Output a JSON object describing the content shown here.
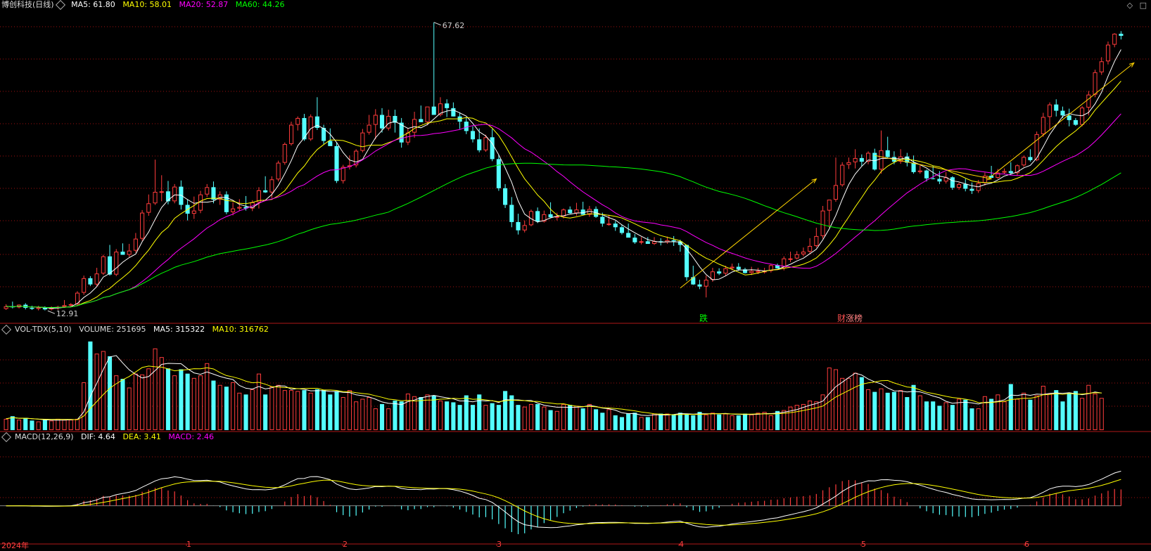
{
  "header": {
    "title": "博创科技(日线)",
    "ma5": "MA5: 61.80",
    "ma10": "MA10: 58.01",
    "ma20": "MA20: 52.87",
    "ma60": "MA60: 44.26"
  },
  "volume_header": {
    "indicator": "VOL-TDX(5,10)",
    "volume": "VOLUME: 251695",
    "ma5": "MA5: 315322",
    "ma10": "MA10: 316762"
  },
  "macd_header": {
    "indicator": "MACD(12,26,9)",
    "dif": "DIF: 4.64",
    "dea": "DEA: 3.41",
    "macd": "MACD: 2.46"
  },
  "annotations": {
    "high": "67.62",
    "low": "12.91",
    "event_drop": "跌",
    "event_cai": "财",
    "event_rise": "涨榜"
  },
  "x_axis": {
    "year": "2024年",
    "months": [
      "1",
      "2",
      "3",
      "4",
      "5",
      "6"
    ]
  },
  "corner": {
    "diamond": "◇",
    "square": "□"
  },
  "colors": {
    "background": "#000000",
    "up": "#ff3c3c",
    "down": "#54ffff",
    "ma5": "#ffffff",
    "ma10": "#ffff00",
    "ma20": "#ff00ff",
    "ma60": "#00ff00",
    "grid": "#a01010"
  },
  "chart_data": {
    "type": "candlestick",
    "price_range": [
      10,
      70
    ],
    "candles": [
      [
        12.5,
        13.4,
        12.3,
        13.0
      ],
      [
        13.0,
        13.9,
        12.6,
        12.8
      ],
      [
        12.8,
        13.4,
        12.6,
        13.3
      ],
      [
        13.3,
        13.6,
        12.4,
        12.7
      ],
      [
        12.7,
        13.1,
        12.3,
        12.5
      ],
      [
        12.5,
        13.1,
        12.2,
        12.8
      ],
      [
        12.8,
        13.0,
        12.2,
        12.4
      ],
      [
        12.4,
        13.0,
        12.2,
        12.7
      ],
      [
        12.7,
        13.1,
        12.3,
        12.9
      ],
      [
        12.9,
        14.2,
        12.7,
        13.2
      ],
      [
        13.2,
        13.6,
        12.9,
        13.4
      ],
      [
        13.4,
        15.9,
        13.1,
        15.6
      ],
      [
        15.6,
        18.9,
        15.2,
        18.4
      ],
      [
        18.4,
        18.8,
        16.9,
        17.2
      ],
      [
        17.2,
        20.4,
        16.9,
        19.3
      ],
      [
        19.3,
        22.9,
        19.0,
        22.6
      ],
      [
        22.6,
        24.8,
        18.9,
        19.1
      ],
      [
        19.1,
        24.0,
        18.8,
        23.5
      ],
      [
        23.5,
        25.1,
        22.9,
        22.9
      ],
      [
        22.9,
        25.0,
        22.5,
        23.7
      ],
      [
        23.7,
        27.1,
        23.3,
        26.0
      ],
      [
        26.0,
        31.5,
        25.6,
        31.0
      ],
      [
        31.0,
        34.5,
        30.4,
        32.8
      ],
      [
        32.8,
        41.2,
        32.5,
        35.0
      ],
      [
        35.0,
        38.2,
        33.2,
        35.1
      ],
      [
        35.1,
        37.1,
        32.6,
        33.2
      ],
      [
        33.2,
        36.5,
        32.8,
        36.0
      ],
      [
        36.0,
        37.2,
        31.6,
        32.5
      ],
      [
        32.5,
        33.6,
        29.5,
        30.8
      ],
      [
        30.8,
        34.1,
        29.8,
        31.4
      ],
      [
        31.4,
        35.2,
        30.9,
        34.5
      ],
      [
        34.5,
        36.5,
        34.0,
        35.9
      ],
      [
        35.9,
        37.0,
        32.8,
        33.5
      ],
      [
        33.5,
        35.1,
        32.5,
        34.5
      ],
      [
        34.5,
        35.1,
        30.7,
        31.1
      ],
      [
        31.1,
        33.0,
        30.5,
        31.8
      ],
      [
        31.8,
        33.6,
        31.4,
        32.1
      ],
      [
        32.1,
        34.2,
        31.4,
        31.8
      ],
      [
        31.8,
        33.4,
        31.3,
        33.0
      ],
      [
        33.0,
        35.9,
        31.8,
        35.3
      ],
      [
        35.3,
        38.0,
        34.8,
        34.9
      ],
      [
        34.9,
        38.0,
        33.8,
        37.4
      ],
      [
        37.4,
        41.0,
        37.0,
        40.6
      ],
      [
        40.6,
        44.5,
        40.2,
        44.2
      ],
      [
        44.2,
        48.5,
        43.9,
        47.9
      ],
      [
        47.9,
        49.5,
        46.8,
        49.2
      ],
      [
        49.2,
        50.0,
        44.8,
        45.1
      ],
      [
        45.1,
        49.9,
        44.8,
        49.5
      ],
      [
        49.5,
        53.2,
        46.9,
        47.3
      ],
      [
        47.3,
        47.9,
        44.2,
        44.8
      ],
      [
        44.8,
        47.2,
        43.9,
        43.8
      ],
      [
        43.8,
        44.5,
        36.7,
        37.1
      ],
      [
        37.1,
        40.2,
        36.6,
        39.8
      ],
      [
        39.8,
        42.0,
        39.3,
        40.1
      ],
      [
        40.1,
        43.2,
        39.7,
        42.9
      ],
      [
        42.9,
        47.1,
        42.6,
        46.4
      ],
      [
        46.4,
        49.8,
        46.0,
        47.9
      ],
      [
        47.9,
        50.9,
        45.1,
        49.8
      ],
      [
        49.8,
        51.1,
        46.4,
        47.2
      ],
      [
        47.2,
        50.8,
        46.8,
        49.6
      ],
      [
        49.6,
        50.8,
        46.4,
        48.3
      ],
      [
        48.3,
        49.2,
        43.5,
        44.5
      ],
      [
        44.5,
        47.2,
        44.0,
        46.4
      ],
      [
        46.4,
        50.4,
        45.4,
        49.0
      ],
      [
        49.0,
        51.6,
        48.7,
        48.4
      ],
      [
        48.4,
        51.0,
        47.8,
        51.4
      ],
      [
        51.4,
        67.6,
        51.0,
        49.8
      ],
      [
        49.8,
        53.2,
        49.5,
        52.0
      ],
      [
        52.0,
        52.8,
        49.4,
        51.1
      ],
      [
        51.1,
        52.2,
        49.5,
        49.5
      ],
      [
        49.5,
        50.3,
        47.1,
        48.5
      ],
      [
        48.5,
        49.3,
        46.1,
        46.7
      ],
      [
        46.7,
        47.6,
        44.5,
        45.1
      ],
      [
        45.1,
        47.2,
        42.6,
        43.0
      ],
      [
        43.0,
        46.0,
        42.7,
        45.5
      ],
      [
        45.5,
        47.1,
        40.9,
        41.3
      ],
      [
        41.3,
        42.1,
        35.2,
        35.7
      ],
      [
        35.7,
        36.5,
        31.9,
        32.5
      ],
      [
        32.5,
        34.0,
        28.2,
        29.2
      ],
      [
        29.2,
        30.8,
        26.8,
        27.6
      ],
      [
        27.6,
        29.5,
        27.2,
        28.6
      ],
      [
        28.6,
        31.6,
        28.4,
        31.3
      ],
      [
        31.3,
        32.0,
        29.0,
        29.3
      ],
      [
        29.3,
        31.4,
        29.1,
        30.7
      ],
      [
        30.7,
        33.0,
        30.1,
        30.1
      ],
      [
        30.1,
        31.0,
        29.5,
        30.3
      ],
      [
        30.3,
        31.8,
        29.9,
        31.6
      ],
      [
        31.6,
        32.2,
        30.8,
        30.9
      ],
      [
        30.9,
        32.9,
        30.4,
        31.6
      ],
      [
        31.6,
        33.1,
        30.6,
        30.6
      ],
      [
        30.6,
        32.3,
        30.2,
        31.7
      ],
      [
        31.7,
        32.2,
        30.0,
        30.2
      ],
      [
        30.2,
        31.0,
        28.3,
        28.9
      ],
      [
        28.9,
        30.6,
        28.5,
        28.9
      ],
      [
        28.9,
        29.4,
        27.5,
        28.2
      ],
      [
        28.2,
        28.7,
        26.8,
        27.1
      ],
      [
        27.1,
        28.9,
        26.5,
        26.2
      ],
      [
        26.2,
        26.9,
        25.0,
        25.3
      ],
      [
        25.3,
        26.3,
        24.9,
        25.5
      ],
      [
        25.5,
        26.3,
        25.0,
        25.0
      ],
      [
        25.0,
        26.3,
        24.8,
        25.5
      ],
      [
        25.5,
        26.1,
        24.7,
        25.3
      ],
      [
        25.3,
        26.4,
        25.0,
        25.7
      ],
      [
        25.7,
        26.5,
        24.6,
        25.5
      ],
      [
        25.5,
        25.8,
        23.5,
        24.8
      ],
      [
        24.8,
        22.5,
        17.9,
        18.6
      ],
      [
        18.6,
        20.8,
        17.1,
        17.2
      ],
      [
        17.2,
        18.1,
        16.3,
        16.8
      ],
      [
        16.8,
        18.9,
        14.7,
        18.1
      ],
      [
        18.1,
        20.4,
        17.7,
        19.7
      ],
      [
        19.7,
        20.3,
        19.0,
        19.3
      ],
      [
        19.3,
        20.8,
        18.9,
        20.3
      ],
      [
        20.3,
        21.2,
        19.9,
        20.6
      ],
      [
        20.6,
        21.3,
        19.8,
        20.1
      ],
      [
        20.1,
        20.4,
        19.3,
        19.4
      ],
      [
        19.4,
        20.6,
        19.0,
        19.8
      ],
      [
        19.8,
        20.4,
        19.2,
        19.8
      ],
      [
        19.8,
        20.4,
        19.3,
        19.8
      ],
      [
        19.8,
        21.1,
        19.5,
        20.9
      ],
      [
        20.9,
        21.2,
        20.3,
        20.3
      ],
      [
        20.3,
        22.6,
        19.9,
        22.2
      ],
      [
        22.2,
        23.5,
        21.5,
        22.2
      ],
      [
        22.2,
        23.6,
        22.0,
        23.0
      ],
      [
        23.0,
        24.3,
        22.6,
        23.5
      ],
      [
        23.5,
        26.1,
        23.1,
        24.6
      ],
      [
        24.6,
        28.1,
        24.3,
        26.5
      ],
      [
        26.5,
        32.3,
        26.0,
        31.4
      ],
      [
        31.4,
        33.1,
        28.1,
        33.5
      ],
      [
        33.5,
        41.6,
        33.1,
        36.3
      ],
      [
        36.3,
        40.7,
        36.0,
        40.2
      ],
      [
        40.2,
        41.6,
        39.4,
        40.7
      ],
      [
        40.7,
        43.2,
        39.5,
        41.5
      ],
      [
        41.5,
        42.2,
        40.0,
        40.8
      ],
      [
        40.8,
        42.8,
        40.3,
        42.5
      ],
      [
        42.5,
        43.3,
        39.1,
        39.3
      ],
      [
        39.3,
        46.8,
        38.5,
        43.0
      ],
      [
        43.0,
        45.6,
        41.4,
        41.7
      ],
      [
        41.7,
        42.8,
        40.3,
        40.8
      ],
      [
        40.8,
        43.2,
        40.4,
        41.8
      ],
      [
        41.8,
        42.5,
        39.9,
        40.6
      ],
      [
        40.6,
        42.0,
        38.5,
        38.8
      ],
      [
        38.8,
        40.1,
        38.5,
        39.1
      ],
      [
        39.1,
        39.3,
        37.0,
        37.6
      ],
      [
        37.6,
        40.0,
        37.4,
        37.5
      ],
      [
        37.5,
        39.0,
        36.5,
        37.0
      ],
      [
        37.0,
        38.8,
        36.6,
        37.8
      ],
      [
        37.8,
        38.0,
        35.4,
        35.8
      ],
      [
        35.8,
        36.8,
        35.4,
        36.5
      ],
      [
        36.5,
        37.5,
        35.1,
        35.6
      ],
      [
        35.6,
        36.8,
        34.6,
        35.2
      ],
      [
        35.2,
        37.3,
        34.8,
        36.7
      ],
      [
        36.7,
        38.7,
        36.2,
        38.1
      ],
      [
        38.1,
        40.0,
        37.7,
        37.7
      ],
      [
        37.7,
        39.4,
        37.5,
        38.7
      ],
      [
        38.7,
        39.5,
        38.4,
        39.0
      ],
      [
        39.0,
        40.7,
        38.2,
        38.6
      ],
      [
        38.6,
        40.3,
        38.1,
        40.1
      ],
      [
        40.1,
        42.0,
        39.8,
        41.7
      ],
      [
        41.7,
        43.2,
        40.8,
        41.1
      ],
      [
        41.1,
        46.6,
        40.9,
        46.1
      ],
      [
        46.1,
        50.2,
        45.6,
        49.4
      ],
      [
        49.4,
        52.2,
        46.8,
        51.8
      ],
      [
        51.8,
        52.8,
        49.5,
        50.6
      ],
      [
        50.6,
        51.4,
        49.2,
        49.7
      ],
      [
        49.7,
        51.0,
        47.6,
        48.8
      ],
      [
        48.8,
        49.2,
        47.7,
        47.9
      ],
      [
        47.9,
        51.5,
        47.6,
        51.2
      ],
      [
        51.2,
        54.4,
        49.7,
        53.7
      ],
      [
        53.7,
        58.5,
        53.2,
        58.0
      ],
      [
        58.0,
        60.9,
        57.5,
        60.1
      ],
      [
        60.1,
        63.9,
        59.5,
        63.3
      ],
      [
        63.3,
        65.5,
        62.8,
        65.4
      ],
      [
        65.4,
        65.9,
        64.3,
        65.0
      ]
    ],
    "volume_range": [
      0,
      1100000
    ],
    "volume": [
      130000,
      160000,
      120000,
      140000,
      110000,
      100000,
      120000,
      110000,
      130000,
      120000,
      120000,
      130000,
      550000,
      1020000,
      880000,
      910000,
      850000,
      630000,
      590000,
      490000,
      650000,
      640000,
      710000,
      940000,
      840000,
      710000,
      630000,
      700000,
      650000,
      600000,
      630000,
      770000,
      570000,
      520000,
      500000,
      550000,
      430000,
      410000,
      470000,
      650000,
      410000,
      500000,
      520000,
      460000,
      460000,
      450000,
      460000,
      430000,
      470000,
      460000,
      410000,
      450000,
      380000,
      460000,
      330000,
      360000,
      380000,
      250000,
      300000,
      250000,
      340000,
      330000,
      420000,
      390000,
      380000,
      410000,
      400000,
      340000,
      330000,
      320000,
      290000,
      400000,
      290000,
      410000,
      290000,
      310000,
      290000,
      450000,
      400000,
      290000,
      270000,
      300000,
      300000,
      270000,
      230000,
      220000,
      300000,
      290000,
      280000,
      250000,
      300000,
      240000,
      200000,
      240000,
      170000,
      150000,
      190000,
      200000,
      150000,
      150000,
      190000,
      190000,
      190000,
      180000,
      200000,
      180000,
      170000,
      210000,
      180000,
      200000,
      180000,
      190000,
      170000,
      170000,
      190000,
      180000,
      200000,
      210000,
      170000,
      220000,
      230000,
      270000,
      290000,
      300000,
      340000,
      330000,
      410000,
      720000,
      700000,
      600000,
      600000,
      660000,
      610000,
      470000,
      440000,
      480000,
      430000,
      440000,
      460000,
      380000,
      520000,
      400000,
      330000,
      330000,
      280000,
      320000,
      290000,
      360000,
      350000,
      250000,
      250000,
      390000,
      360000,
      410000,
      330000,
      530000,
      360000,
      430000,
      350000,
      400000,
      510000,
      420000,
      460000,
      330000,
      430000,
      450000,
      370000,
      520000,
      420000,
      370000
    ],
    "macd_range": [
      -7,
      12
    ]
  }
}
